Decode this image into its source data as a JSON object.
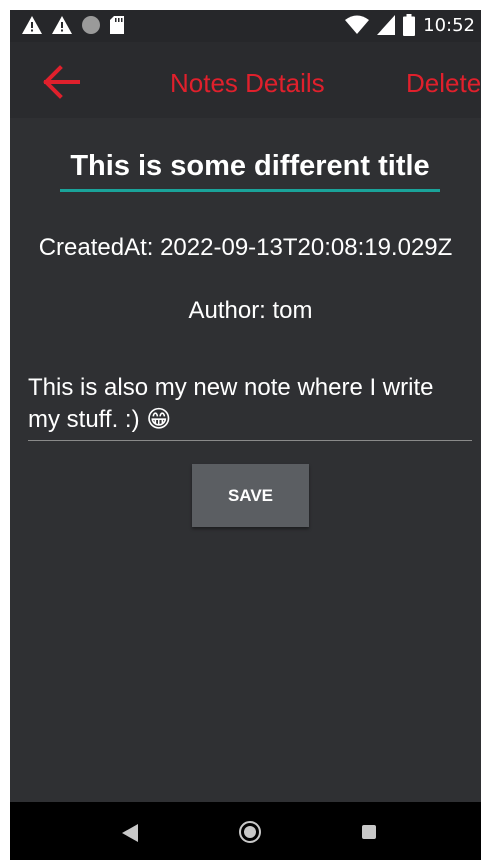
{
  "status_bar": {
    "time": "10:52",
    "icons": [
      "warning-icon",
      "warning-icon",
      "circle-icon",
      "sd-card-icon",
      "wifi-icon",
      "signal-icon",
      "battery-icon"
    ]
  },
  "app_bar": {
    "back_icon": "arrow-left-icon",
    "title": "Notes Details",
    "delete_label": "Delete",
    "accent_color": "#e0202c"
  },
  "note": {
    "title": "This is some different title",
    "created_at": "CreatedAt: 2022-09-13T20:08:19.029Z",
    "author": "Author: tom",
    "body": "This is also my new note where I write my stuff. :) 😁"
  },
  "actions": {
    "save_label": "SAVE"
  },
  "nav_bar": {
    "icons": [
      "nav-back-icon",
      "nav-home-icon",
      "nav-recents-icon"
    ]
  },
  "colors": {
    "background": "#2f3033",
    "title_underline": "#1aa39a",
    "button_bg": "#5b5e62"
  }
}
